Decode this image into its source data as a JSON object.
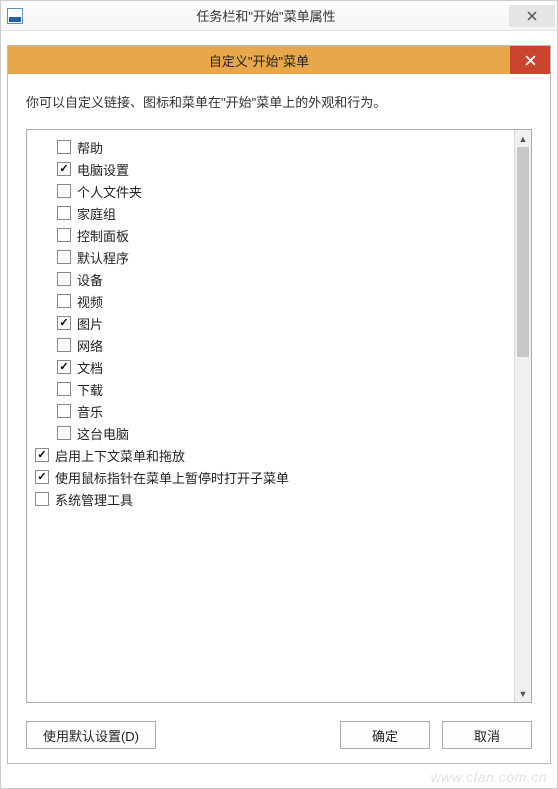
{
  "parent": {
    "title": "任务栏和\"开始\"菜单属性"
  },
  "child": {
    "title": "自定义\"开始\"菜单"
  },
  "description": "你可以自定义链接、图标和菜单在\"开始\"菜单上的外观和行为。",
  "items": [
    {
      "label": "帮助",
      "checked": false,
      "indent": true
    },
    {
      "label": "电脑设置",
      "checked": true,
      "indent": true
    },
    {
      "label": "个人文件夹",
      "checked": false,
      "indent": true
    },
    {
      "label": "家庭组",
      "checked": false,
      "indent": true
    },
    {
      "label": "控制面板",
      "checked": false,
      "indent": true
    },
    {
      "label": "默认程序",
      "checked": false,
      "indent": true
    },
    {
      "label": "设备",
      "checked": false,
      "indent": true
    },
    {
      "label": "视频",
      "checked": false,
      "indent": true
    },
    {
      "label": "图片",
      "checked": true,
      "indent": true
    },
    {
      "label": "网络",
      "checked": false,
      "indent": true
    },
    {
      "label": "文档",
      "checked": true,
      "indent": true
    },
    {
      "label": "下载",
      "checked": false,
      "indent": true
    },
    {
      "label": "音乐",
      "checked": false,
      "indent": true
    },
    {
      "label": "这台电脑",
      "checked": false,
      "indent": true
    },
    {
      "label": "启用上下文菜单和拖放",
      "checked": true,
      "indent": false
    },
    {
      "label": "使用鼠标指针在菜单上暂停时打开子菜单",
      "checked": true,
      "indent": false
    },
    {
      "label": "系统管理工具",
      "checked": false,
      "indent": false
    }
  ],
  "buttons": {
    "defaults": "使用默认设置(D)",
    "ok": "确定",
    "cancel": "取消"
  },
  "watermark": "www.cfan.com.cn"
}
